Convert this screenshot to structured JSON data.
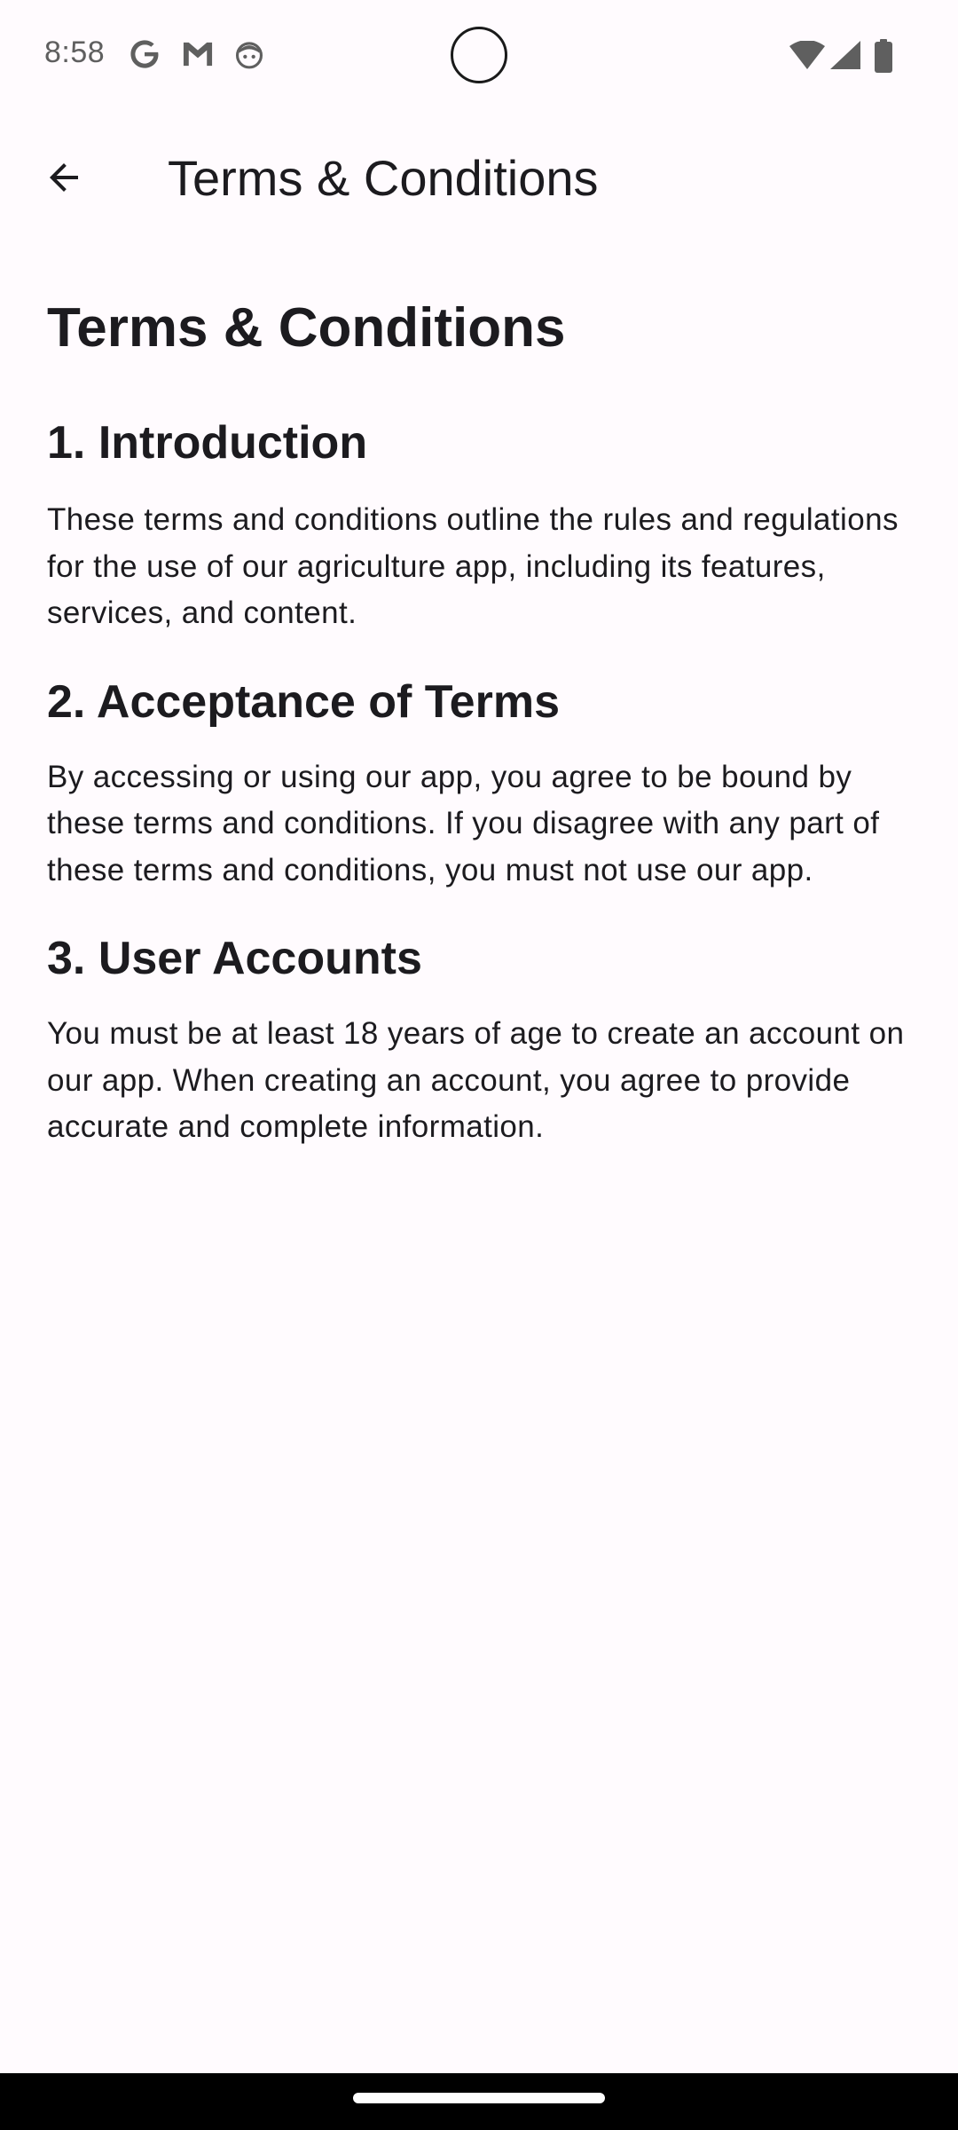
{
  "status_bar": {
    "time": "8:58",
    "notification_icons": [
      "google-icon",
      "gmail-icon",
      "android-head-icon"
    ],
    "system_icons": [
      "wifi-icon",
      "cell-signal-icon",
      "battery-icon"
    ]
  },
  "app_bar": {
    "back_icon": "arrow-back-icon",
    "title": "Terms & Conditions"
  },
  "content": {
    "heading": "Terms & Conditions",
    "sections": [
      {
        "title": "1. Introduction",
        "body": "These terms and conditions outline the rules and regulations for the use of our agriculture app, including its features, services, and content."
      },
      {
        "title": "2. Acceptance of Terms",
        "body": "By accessing or using our app, you agree to be bound by these terms and conditions. If you disagree with any part of these terms and conditions, you must not use our app."
      },
      {
        "title": "3. User Accounts",
        "body": "You must be at least 18 years of age to create an account on our app. When creating an account, you agree to provide accurate and complete information."
      }
    ]
  },
  "colors": {
    "background": "#fffbfe",
    "text": "#1c1b1f",
    "status_icons": "#5f5f5f",
    "nav_bar": "#000000"
  }
}
